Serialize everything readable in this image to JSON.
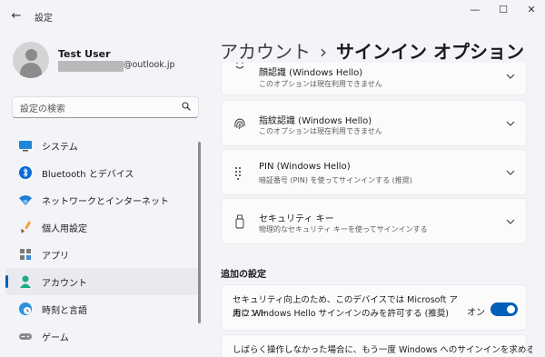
{
  "window": {
    "title": "設定",
    "back_glyph": "←",
    "min": "—",
    "max": "☐",
    "close": "✕"
  },
  "profile": {
    "name": "Test User",
    "email_domain": "@outlook.jp"
  },
  "search": {
    "placeholder": "設定の検索"
  },
  "nav": {
    "items": [
      {
        "label": "システム",
        "icon": "monitor-icon"
      },
      {
        "label": "Bluetooth とデバイス",
        "icon": "bluetooth-icon"
      },
      {
        "label": "ネットワークとインターネット",
        "icon": "wifi-icon"
      },
      {
        "label": "個人用設定",
        "icon": "brush-icon"
      },
      {
        "label": "アプリ",
        "icon": "apps-icon"
      },
      {
        "label": "アカウント",
        "icon": "person-icon",
        "selected": true
      },
      {
        "label": "時刻と言語",
        "icon": "globe-clock-icon"
      },
      {
        "label": "ゲーム",
        "icon": "gamepad-icon"
      }
    ]
  },
  "header": {
    "parent": "アカウント",
    "separator": "›",
    "current": "サインイン オプション"
  },
  "options": [
    {
      "title": "顔認識 (Windows Hello)",
      "subtitle": "このオプションは現在利用できません",
      "icon": "face-icon"
    },
    {
      "title": "指紋認識 (Windows Hello)",
      "subtitle": "このオプションは現在利用できません",
      "icon": "fingerprint-icon"
    },
    {
      "title": "PIN (Windows Hello)",
      "subtitle": "暗証番号 (PIN) を使ってサインインする (推奨)",
      "icon": "pin-keypad-icon"
    },
    {
      "title": "セキュリティ キー",
      "subtitle": "物理的なセキュリティ キーを使ってサインインする",
      "icon": "usb-key-icon"
    }
  ],
  "additional": {
    "heading": "追加の設定",
    "hello_only": {
      "line1": "セキュリティ向上のため、このデバイスでは Microsoft アカウント",
      "line2": "用に Windows Hello サインインのみを許可する (推奨)",
      "state_label": "オン",
      "enabled": true
    },
    "away_text": "しばらく操作しなかった場合に、もう一度 Windows へのサインインを求めるタ"
  },
  "colors": {
    "accent": "#005fb8",
    "background": "#f2f4f8",
    "card": "#fbfbfb"
  }
}
